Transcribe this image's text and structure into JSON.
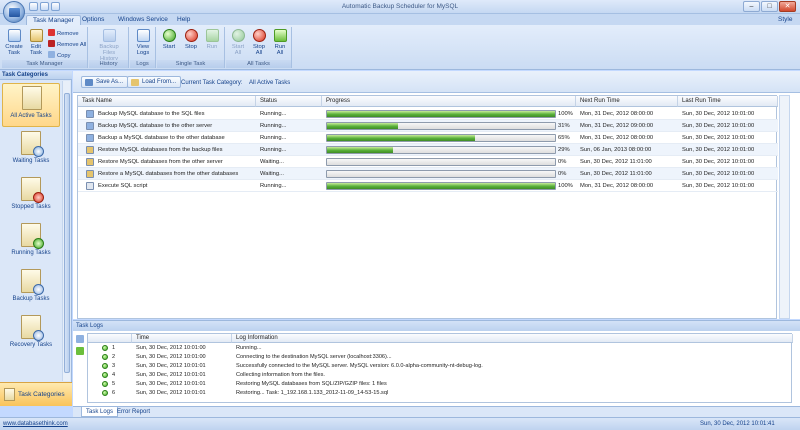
{
  "window": {
    "title": "Automatic Backup Scheduler for MySQL",
    "style_label": "Style"
  },
  "tabs": [
    "Task Manager",
    "Options",
    "Windows Service",
    "Help"
  ],
  "ribbon": {
    "groups": [
      {
        "label": "Task Manager",
        "buttons": [
          "Create\nTask",
          "Edit\nTask"
        ],
        "small": [
          "Remove",
          "Remove All",
          "Copy"
        ]
      },
      {
        "label": "History",
        "buttons": [
          "Backup\nFiles History"
        ]
      },
      {
        "label": "Logs",
        "buttons": [
          "View\nLogs"
        ]
      },
      {
        "label": "Single Task",
        "buttons": [
          "Start",
          "Stop",
          "Run"
        ]
      },
      {
        "label": "All Tasks",
        "buttons": [
          "Start\nAll",
          "Stop\nAll",
          "Run\nAll"
        ]
      }
    ]
  },
  "left": {
    "header": "Task Categories",
    "items": [
      "All Active Tasks",
      "Waiting Tasks",
      "Stopped Tasks",
      "Running Tasks",
      "Backup Tasks",
      "Recovery Tasks"
    ],
    "bottom": "Task Categories"
  },
  "toolbar": {
    "save": "Save As...",
    "load": "Load From...",
    "current_label": "Current Task Category:",
    "current_value": "All Active Tasks"
  },
  "grid": {
    "columns": [
      "Task Name",
      "Status",
      "Progress",
      "Next Run Time",
      "Last Run Time"
    ],
    "rows": [
      {
        "name": "Backup MySQL database to the SQL files",
        "status": "Running...",
        "progress": 100,
        "pct": "100%",
        "next": "Mon, 31 Dec, 2012 08:00:00",
        "last": "Sun, 30 Dec, 2012 10:01:00"
      },
      {
        "name": "Backup MySQL database to the other server",
        "status": "Running...",
        "progress": 31,
        "pct": "31%",
        "next": "Mon, 31 Dec, 2012 09:00:00",
        "last": "Sun, 30 Dec, 2012 10:01:00"
      },
      {
        "name": "Backup a MySQL database to the other database",
        "status": "Running...",
        "progress": 65,
        "pct": "65%",
        "next": "Mon, 31 Dec, 2012 08:00:00",
        "last": "Sun, 30 Dec, 2012 10:01:00"
      },
      {
        "name": "Restore MySQL databases from the backup files",
        "status": "Running...",
        "progress": 29,
        "pct": "29%",
        "next": "Sun, 06 Jan, 2013 08:00:00",
        "last": "Sun, 30 Dec, 2012 10:01:00"
      },
      {
        "name": "Restore MySQL databases from the other server",
        "status": "Waiting...",
        "progress": 0,
        "pct": "0%",
        "next": "Sun, 30 Dec, 2012 11:01:00",
        "last": "Sun, 30 Dec, 2012 10:01:00"
      },
      {
        "name": "Restore a MySQL databases from the other databases",
        "status": "Waiting...",
        "progress": 0,
        "pct": "0%",
        "next": "Sun, 30 Dec, 2012 11:01:00",
        "last": "Sun, 30 Dec, 2012 10:01:00"
      },
      {
        "name": "Execute SQL script",
        "status": "Running...",
        "progress": 100,
        "pct": "100%",
        "next": "Mon, 31 Dec, 2012 08:00:00",
        "last": "Sun, 30 Dec, 2012 10:01:00"
      }
    ]
  },
  "logs": {
    "header": "Task Logs",
    "columns": [
      "Time",
      "Log Information"
    ],
    "rows": [
      {
        "n": "1",
        "time": "Sun, 30 Dec, 2012 10:01:00",
        "info": "Running..."
      },
      {
        "n": "2",
        "time": "Sun, 30 Dec, 2012 10:01:00",
        "info": "Connecting to the destination MySQL server (localhost:3306)..."
      },
      {
        "n": "3",
        "time": "Sun, 30 Dec, 2012 10:01:01",
        "info": "Successfully connected to the MySQL server. MySQL version: 6.0.0-alpha-community-nt-debug-log."
      },
      {
        "n": "4",
        "time": "Sun, 30 Dec, 2012 10:01:01",
        "info": "Collecting information from the files."
      },
      {
        "n": "5",
        "time": "Sun, 30 Dec, 2012 10:01:01",
        "info": "Restoring MySQL databases from SQL/ZIP/GZIP files: 1 files"
      },
      {
        "n": "6",
        "time": "Sun, 30 Dec, 2012 10:01:01",
        "info": "Restoring... Task: 1_192.168.1.133_2012-11-09_14-53-15.sql"
      }
    ]
  },
  "bottomtabs": [
    "Task Logs",
    "Error Report"
  ],
  "status": {
    "link": "www.databasethink.com",
    "datetime": "Sun, 30 Dec, 2012 10:01:41"
  }
}
